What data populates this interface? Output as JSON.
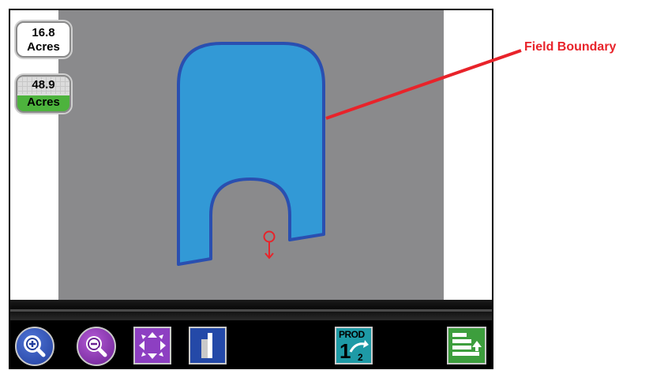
{
  "acres_indicators": [
    {
      "value": "16.8",
      "unit": "Acres"
    },
    {
      "value": "48.9",
      "unit": "Acres"
    }
  ],
  "callout": {
    "label": "Field Boundary",
    "color": "#e8232a"
  },
  "toolbar": {
    "zoom_in_icon": "magnifier-plus-icon",
    "zoom_out_icon": "magnifier-minus-icon",
    "pan_icon": "four-way-arrows-icon",
    "split_icon": "split-view-icon",
    "product_button": {
      "label": "PROD",
      "from": "1",
      "to": "2"
    },
    "layers_icon": "layers-arrow-icon"
  },
  "colors": {
    "field_fill": "#3299d6",
    "field_border": "#2a4fb0",
    "map_background": "#8a8a8c",
    "vehicle": "#e8232a"
  }
}
